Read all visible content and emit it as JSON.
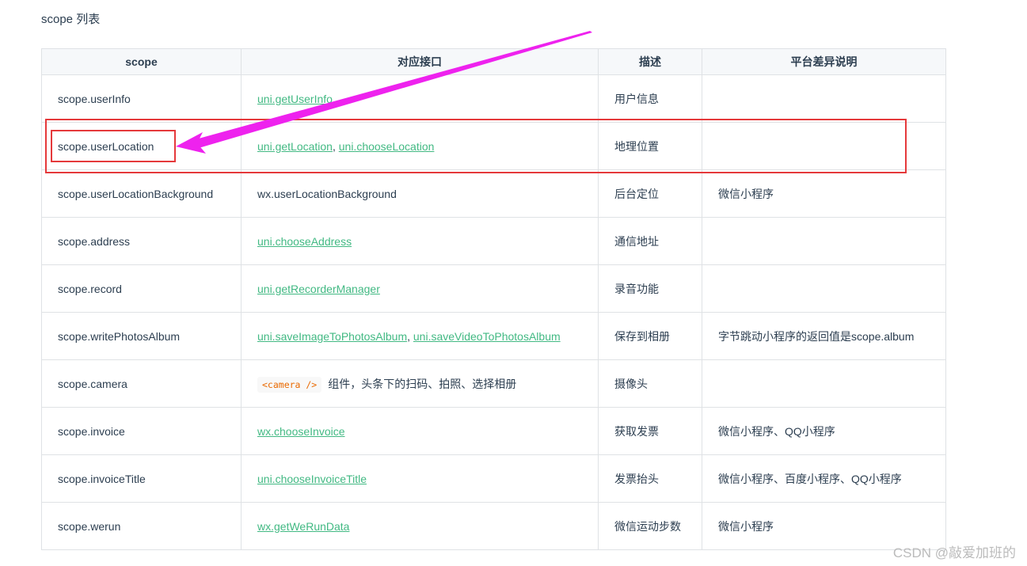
{
  "section_title": "scope 列表",
  "table": {
    "headers": [
      "scope",
      "对应接口",
      "描述",
      "平台差异说明"
    ],
    "rows": [
      {
        "scope": "scope.userInfo",
        "api": [
          {
            "text": "uni.getUserInfo",
            "link": true
          }
        ],
        "desc": "用户信息",
        "platform": ""
      },
      {
        "scope": "scope.userLocation",
        "api": [
          {
            "text": "uni.getLocation",
            "link": true
          },
          {
            "text": "uni.chooseLocation",
            "link": true
          }
        ],
        "desc": "地理位置",
        "platform": ""
      },
      {
        "scope": "scope.userLocationBackground",
        "api": [
          {
            "text": "wx.userLocationBackground",
            "link": false
          }
        ],
        "desc": "后台定位",
        "platform": "微信小程序"
      },
      {
        "scope": "scope.address",
        "api": [
          {
            "text": "uni.chooseAddress",
            "link": true
          }
        ],
        "desc": "通信地址",
        "platform": ""
      },
      {
        "scope": "scope.record",
        "api": [
          {
            "text": "uni.getRecorderManager",
            "link": true
          }
        ],
        "desc": "录音功能",
        "platform": ""
      },
      {
        "scope": "scope.writePhotosAlbum",
        "api": [
          {
            "text": "uni.saveImageToPhotosAlbum",
            "link": true
          },
          {
            "text": "uni.saveVideoToPhotosAlbum",
            "link": true
          }
        ],
        "desc": "保存到相册",
        "platform": "字节跳动小程序的返回值是scope.album"
      },
      {
        "scope": "scope.camera",
        "api": [
          {
            "text": "<camera />",
            "code": true
          },
          {
            "text": "组件，头条下的扫码、拍照、选择相册",
            "link": false
          }
        ],
        "desc": "摄像头",
        "platform": ""
      },
      {
        "scope": "scope.invoice",
        "api": [
          {
            "text": "wx.chooseInvoice",
            "link": true
          }
        ],
        "desc": "获取发票",
        "platform": "微信小程序、QQ小程序"
      },
      {
        "scope": "scope.invoiceTitle",
        "api": [
          {
            "text": "uni.chooseInvoiceTitle",
            "link": true
          }
        ],
        "desc": "发票抬头",
        "platform": "微信小程序、百度小程序、QQ小程序"
      },
      {
        "scope": "scope.werun",
        "api": [
          {
            "text": "wx.getWeRunData",
            "link": true
          }
        ],
        "desc": "微信运动步数",
        "platform": "微信小程序"
      }
    ],
    "separator": ", "
  },
  "annotations": {
    "box_color": "#e5393b",
    "arrow_color": "#ee22ee"
  },
  "watermark": "CSDN @敲爱加班的",
  "colors": {
    "link": "#42b983",
    "text": "#2c3e50",
    "header_bg": "#f6f8fa",
    "border": "#dfe2e5",
    "code": "#e96900"
  }
}
